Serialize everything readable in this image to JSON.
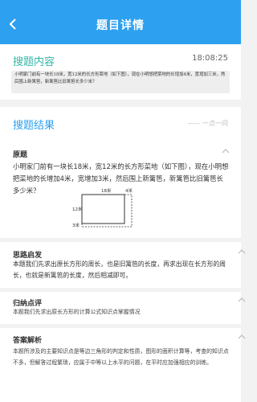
{
  "header": {
    "title": "题目详情"
  },
  "search_content": {
    "title": "搜题内容",
    "time": "18:08:25",
    "question": "小明家门前有一块长18米，宽12米的长方形菜地（如下图），现在小明想把菜地的长增加4米，宽增加三米，然后围上新篱笆，新篱笆比旧篱笆长多少米？"
  },
  "result": {
    "title": "搜题结果",
    "dash_label": "—— 一点一问",
    "original": {
      "heading": "原题",
      "text": "小明家门前有一块长18米，宽12米的长方形菜地（如下图），现在小明想把菜地的长增加4米，宽增加3米，然后围上新篱笆，新篱笆比旧篱笆长多少米？",
      "diagram": {
        "top_long": "18米",
        "top_short": "4米",
        "left_long": "12米",
        "left_short": "3米"
      }
    },
    "thinking": {
      "heading": "思路启发",
      "text": "本题我们先求出原长方形的周长，也是旧篱笆的长度，再求出现在长方形的周长，也就是新篱笆的长度，然后相减即可。"
    },
    "summary": {
      "heading": "归纳点评",
      "text": "本题我们先求出原长方形的计算公式知识点掌握情况"
    },
    "answer": {
      "heading": "答案解析",
      "text": "本题所涉及的主要知识点是等边三角形的判定和性质，图形的面积计算等，考查的知识点不多，但解答过程繁琐，应属于中等以上水平的问题，在平时应加强相应的训练。"
    }
  }
}
